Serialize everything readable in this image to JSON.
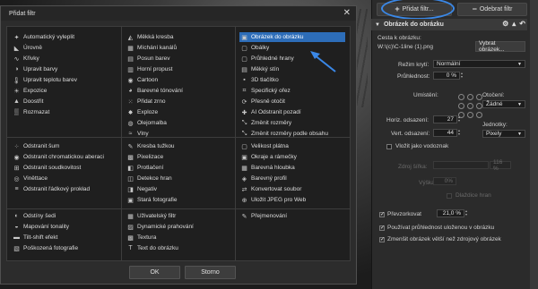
{
  "dialog": {
    "title": "Přidat filtr",
    "close_glyph": "✕",
    "ok_label": "OK",
    "cancel_label": "Storno",
    "filters": [
      {
        "label": "Automatický vyleplit",
        "icon": "magic-wand-icon",
        "glyph": "✦"
      },
      {
        "label": "Úrovně",
        "icon": "levels-icon",
        "glyph": "◣"
      },
      {
        "label": "Křivky",
        "icon": "curves-icon",
        "glyph": "∿"
      },
      {
        "label": "Upravit barvy",
        "icon": "color-adjust-icon",
        "glyph": "◑"
      },
      {
        "label": "Upravit teplotu barev",
        "icon": "thermometer-icon",
        "glyph": "🌡"
      },
      {
        "label": "Expozice",
        "icon": "exposure-icon",
        "glyph": "☀"
      },
      {
        "label": "Doostřit",
        "icon": "sharpen-icon",
        "glyph": "▲"
      },
      {
        "label": "Rozmazat",
        "icon": "blur-icon",
        "glyph": "▒"
      },
      {
        "label": "Odstranit šum",
        "icon": "denoise-icon",
        "glyph": "⁘"
      },
      {
        "label": "Odstranit chromatickou aberaci",
        "icon": "chromatic-icon",
        "glyph": "◉"
      },
      {
        "label": "Odstranit soudkovitost",
        "icon": "barrel-icon",
        "glyph": "⊞"
      },
      {
        "label": "Viněttace",
        "icon": "vignette-icon",
        "glyph": "◎"
      },
      {
        "label": "Odstranit řádkový prokład",
        "icon": "interlace-icon",
        "glyph": "≡"
      },
      {
        "label": "Odstíny šedi",
        "icon": "grayscale-icon",
        "glyph": "◐"
      },
      {
        "label": "Mapování tonality",
        "icon": "tonemap-icon",
        "glyph": "◒"
      },
      {
        "label": "Tilt-shift efekt",
        "icon": "tiltshift-icon",
        "glyph": "▬"
      },
      {
        "label": "Poškozená fotografie",
        "icon": "damaged-photo-icon",
        "glyph": "▧"
      },
      {
        "label": "Měkká kresba",
        "icon": "soft-draw-icon",
        "glyph": "◭"
      },
      {
        "label": "Míchání kanálů",
        "icon": "channel-mix-icon",
        "glyph": "▦"
      },
      {
        "label": "Posun barev",
        "icon": "color-shift-icon",
        "glyph": "▤"
      },
      {
        "label": "Horní propust",
        "icon": "highpass-icon",
        "glyph": "▥"
      },
      {
        "label": "Cartoon",
        "icon": "cartoon-icon",
        "glyph": "◉"
      },
      {
        "label": "Barevné tónování",
        "icon": "toning-icon",
        "glyph": "◕"
      },
      {
        "label": "Přidat zrno",
        "icon": "grain-icon",
        "glyph": "⁙"
      },
      {
        "label": "Exploze",
        "icon": "explode-icon",
        "glyph": "✸"
      },
      {
        "label": "Olejomalba",
        "icon": "oil-paint-icon",
        "glyph": "◍"
      },
      {
        "label": "Vlny",
        "icon": "waves-icon",
        "glyph": "≈"
      },
      {
        "label": "Kresba tužkou",
        "icon": "pencil-icon",
        "glyph": "✎"
      },
      {
        "label": "Pixelizace",
        "icon": "pixelate-icon",
        "glyph": "▩"
      },
      {
        "label": "Protlačení",
        "icon": "emboss-icon",
        "glyph": "◧"
      },
      {
        "label": "Detekce hran",
        "icon": "edges-icon",
        "glyph": "◫"
      },
      {
        "label": "Negativ",
        "icon": "negative-icon",
        "glyph": "◨"
      },
      {
        "label": "Stará fotografie",
        "icon": "old-photo-icon",
        "glyph": "▣"
      },
      {
        "label": "Uživatelský filtr",
        "icon": "custom-filter-icon",
        "glyph": "▦"
      },
      {
        "label": "Dynamické prahování",
        "icon": "threshold-icon",
        "glyph": "▨"
      },
      {
        "label": "Textura",
        "icon": "texture-icon",
        "glyph": "▩"
      },
      {
        "label": "Text do obrázku",
        "icon": "text-icon",
        "glyph": "T"
      },
      {
        "label": "Obrázek do obrázku",
        "icon": "image-icon",
        "glyph": "▣"
      },
      {
        "label": "Obálky",
        "icon": "frame-icon",
        "glyph": "▢"
      },
      {
        "label": "Průhledné hrany",
        "icon": "transparent-edges-icon",
        "glyph": "▢"
      },
      {
        "label": "Měkký stín",
        "icon": "soft-shadow-icon",
        "glyph": "▤"
      },
      {
        "label": "3D tlačítko",
        "icon": "button3d-icon",
        "glyph": "▪"
      },
      {
        "label": "Specifický ořez",
        "icon": "crop-icon",
        "glyph": "⌗"
      },
      {
        "label": "Přesně otočit",
        "icon": "rotate-icon",
        "glyph": "⟳"
      },
      {
        "label": "AI Odstranit pozadí",
        "icon": "ai-bg-icon",
        "glyph": "✚"
      },
      {
        "label": "Změnit rozměry",
        "icon": "resize-icon",
        "glyph": "⤡"
      },
      {
        "label": "Změnit rozměry podle obsahu",
        "icon": "content-resize-icon",
        "glyph": "⤡"
      },
      {
        "label": "Velikost plátna",
        "icon": "canvas-icon",
        "glyph": "▢"
      },
      {
        "label": "Okraje a rámečky",
        "icon": "border-icon",
        "glyph": "▣"
      },
      {
        "label": "Barevná hloubka",
        "icon": "depth-icon",
        "glyph": "▦"
      },
      {
        "label": "Barevný profil",
        "icon": "profile-icon",
        "glyph": "◈"
      },
      {
        "label": "Konvertovat soubor",
        "icon": "convert-icon",
        "glyph": "⇄"
      },
      {
        "label": "Uložit JPEG pro Web",
        "icon": "web-icon",
        "glyph": "⊕"
      },
      {
        "label": "Přejmenování",
        "icon": "rename-icon",
        "glyph": "✎"
      }
    ]
  },
  "panel": {
    "add_filter_label": "Přidat filtr...",
    "remove_filter_label": "Odebrat filtr",
    "section_title": "Obrázek do obrázku",
    "path_label": "Cesta k obrázku:",
    "path_value": "W:\\(c)\\C-1line (1).png",
    "browse_label": "Vybrat obrázek...",
    "blend_label": "Režim krytí:",
    "blend_value": "Normální",
    "opacity_label": "Průhlednost:",
    "opacity_value": "0 %",
    "placement_label": "Umístění:",
    "rotation_label": "Otočení:",
    "rotation_value": "Žádné",
    "hoffset_label": "Horiz. odsazení:",
    "hoffset_value": "27",
    "voffset_label": "Vert. odsazení:",
    "voffset_value": "44",
    "units_label": "Jednotky:",
    "units_value": "Pixely",
    "watermark_label": "Vložit jako vodoznak",
    "source_width_label": "Zdroj šířka:",
    "source_width_value": "116 %",
    "height_label": "Výška:",
    "height_value": "0%",
    "tile_label": "Dlaždice hran",
    "oversample_label": "Převzorkovat",
    "oversample_value": "21,0 %",
    "use_saved_label": "Používat průhlednost uloženou v obrázku",
    "shrink_label": "Zmenšit obrázek větší než zdrojový obrázek"
  },
  "colors": {
    "accent": "#2d6db8",
    "annotation": "#3a88e8"
  }
}
